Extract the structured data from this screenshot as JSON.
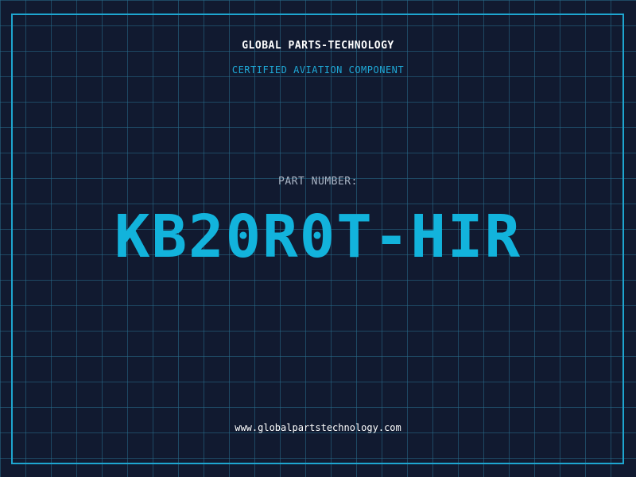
{
  "header": {
    "company": "GLOBAL PARTS-TECHNOLOGY",
    "subtitle": "CERTIFIED AVIATION COMPONENT"
  },
  "part": {
    "label": "PART NUMBER:",
    "number": "KB20R0T-HIR"
  },
  "footer": {
    "website": "www.globalpartstechnology.com"
  },
  "colors": {
    "background": "#111a30",
    "grid": "#286e8c",
    "accent": "#1ea6d0",
    "text": "#ffffff",
    "label": "#a9b4c4"
  }
}
